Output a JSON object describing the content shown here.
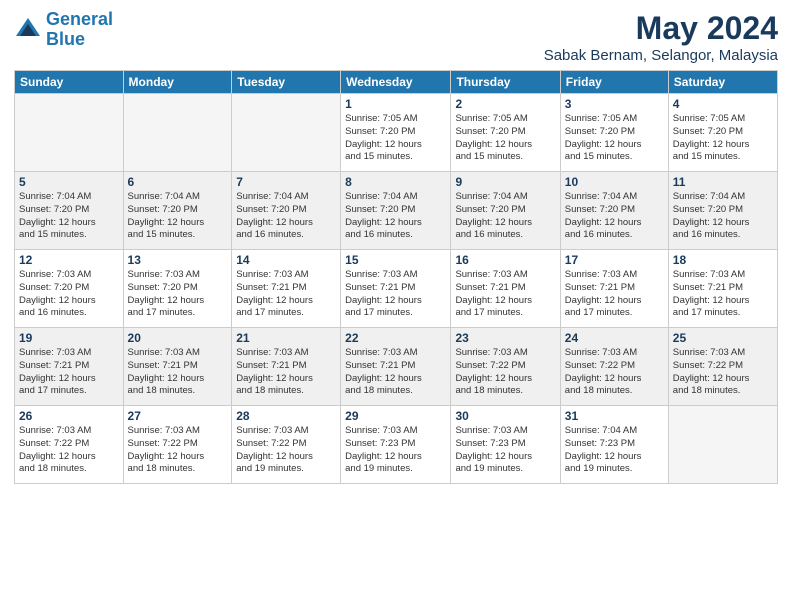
{
  "header": {
    "logo_line1": "General",
    "logo_line2": "Blue",
    "title": "May 2024",
    "subtitle": "Sabak Bernam, Selangor, Malaysia"
  },
  "weekdays": [
    "Sunday",
    "Monday",
    "Tuesday",
    "Wednesday",
    "Thursday",
    "Friday",
    "Saturday"
  ],
  "weeks": [
    [
      {
        "num": "",
        "info": ""
      },
      {
        "num": "",
        "info": ""
      },
      {
        "num": "",
        "info": ""
      },
      {
        "num": "1",
        "info": "Sunrise: 7:05 AM\nSunset: 7:20 PM\nDaylight: 12 hours\nand 15 minutes."
      },
      {
        "num": "2",
        "info": "Sunrise: 7:05 AM\nSunset: 7:20 PM\nDaylight: 12 hours\nand 15 minutes."
      },
      {
        "num": "3",
        "info": "Sunrise: 7:05 AM\nSunset: 7:20 PM\nDaylight: 12 hours\nand 15 minutes."
      },
      {
        "num": "4",
        "info": "Sunrise: 7:05 AM\nSunset: 7:20 PM\nDaylight: 12 hours\nand 15 minutes."
      }
    ],
    [
      {
        "num": "5",
        "info": "Sunrise: 7:04 AM\nSunset: 7:20 PM\nDaylight: 12 hours\nand 15 minutes."
      },
      {
        "num": "6",
        "info": "Sunrise: 7:04 AM\nSunset: 7:20 PM\nDaylight: 12 hours\nand 15 minutes."
      },
      {
        "num": "7",
        "info": "Sunrise: 7:04 AM\nSunset: 7:20 PM\nDaylight: 12 hours\nand 16 minutes."
      },
      {
        "num": "8",
        "info": "Sunrise: 7:04 AM\nSunset: 7:20 PM\nDaylight: 12 hours\nand 16 minutes."
      },
      {
        "num": "9",
        "info": "Sunrise: 7:04 AM\nSunset: 7:20 PM\nDaylight: 12 hours\nand 16 minutes."
      },
      {
        "num": "10",
        "info": "Sunrise: 7:04 AM\nSunset: 7:20 PM\nDaylight: 12 hours\nand 16 minutes."
      },
      {
        "num": "11",
        "info": "Sunrise: 7:04 AM\nSunset: 7:20 PM\nDaylight: 12 hours\nand 16 minutes."
      }
    ],
    [
      {
        "num": "12",
        "info": "Sunrise: 7:03 AM\nSunset: 7:20 PM\nDaylight: 12 hours\nand 16 minutes."
      },
      {
        "num": "13",
        "info": "Sunrise: 7:03 AM\nSunset: 7:20 PM\nDaylight: 12 hours\nand 17 minutes."
      },
      {
        "num": "14",
        "info": "Sunrise: 7:03 AM\nSunset: 7:21 PM\nDaylight: 12 hours\nand 17 minutes."
      },
      {
        "num": "15",
        "info": "Sunrise: 7:03 AM\nSunset: 7:21 PM\nDaylight: 12 hours\nand 17 minutes."
      },
      {
        "num": "16",
        "info": "Sunrise: 7:03 AM\nSunset: 7:21 PM\nDaylight: 12 hours\nand 17 minutes."
      },
      {
        "num": "17",
        "info": "Sunrise: 7:03 AM\nSunset: 7:21 PM\nDaylight: 12 hours\nand 17 minutes."
      },
      {
        "num": "18",
        "info": "Sunrise: 7:03 AM\nSunset: 7:21 PM\nDaylight: 12 hours\nand 17 minutes."
      }
    ],
    [
      {
        "num": "19",
        "info": "Sunrise: 7:03 AM\nSunset: 7:21 PM\nDaylight: 12 hours\nand 17 minutes."
      },
      {
        "num": "20",
        "info": "Sunrise: 7:03 AM\nSunset: 7:21 PM\nDaylight: 12 hours\nand 18 minutes."
      },
      {
        "num": "21",
        "info": "Sunrise: 7:03 AM\nSunset: 7:21 PM\nDaylight: 12 hours\nand 18 minutes."
      },
      {
        "num": "22",
        "info": "Sunrise: 7:03 AM\nSunset: 7:21 PM\nDaylight: 12 hours\nand 18 minutes."
      },
      {
        "num": "23",
        "info": "Sunrise: 7:03 AM\nSunset: 7:22 PM\nDaylight: 12 hours\nand 18 minutes."
      },
      {
        "num": "24",
        "info": "Sunrise: 7:03 AM\nSunset: 7:22 PM\nDaylight: 12 hours\nand 18 minutes."
      },
      {
        "num": "25",
        "info": "Sunrise: 7:03 AM\nSunset: 7:22 PM\nDaylight: 12 hours\nand 18 minutes."
      }
    ],
    [
      {
        "num": "26",
        "info": "Sunrise: 7:03 AM\nSunset: 7:22 PM\nDaylight: 12 hours\nand 18 minutes."
      },
      {
        "num": "27",
        "info": "Sunrise: 7:03 AM\nSunset: 7:22 PM\nDaylight: 12 hours\nand 18 minutes."
      },
      {
        "num": "28",
        "info": "Sunrise: 7:03 AM\nSunset: 7:22 PM\nDaylight: 12 hours\nand 19 minutes."
      },
      {
        "num": "29",
        "info": "Sunrise: 7:03 AM\nSunset: 7:23 PM\nDaylight: 12 hours\nand 19 minutes."
      },
      {
        "num": "30",
        "info": "Sunrise: 7:03 AM\nSunset: 7:23 PM\nDaylight: 12 hours\nand 19 minutes."
      },
      {
        "num": "31",
        "info": "Sunrise: 7:04 AM\nSunset: 7:23 PM\nDaylight: 12 hours\nand 19 minutes."
      },
      {
        "num": "",
        "info": ""
      }
    ]
  ]
}
